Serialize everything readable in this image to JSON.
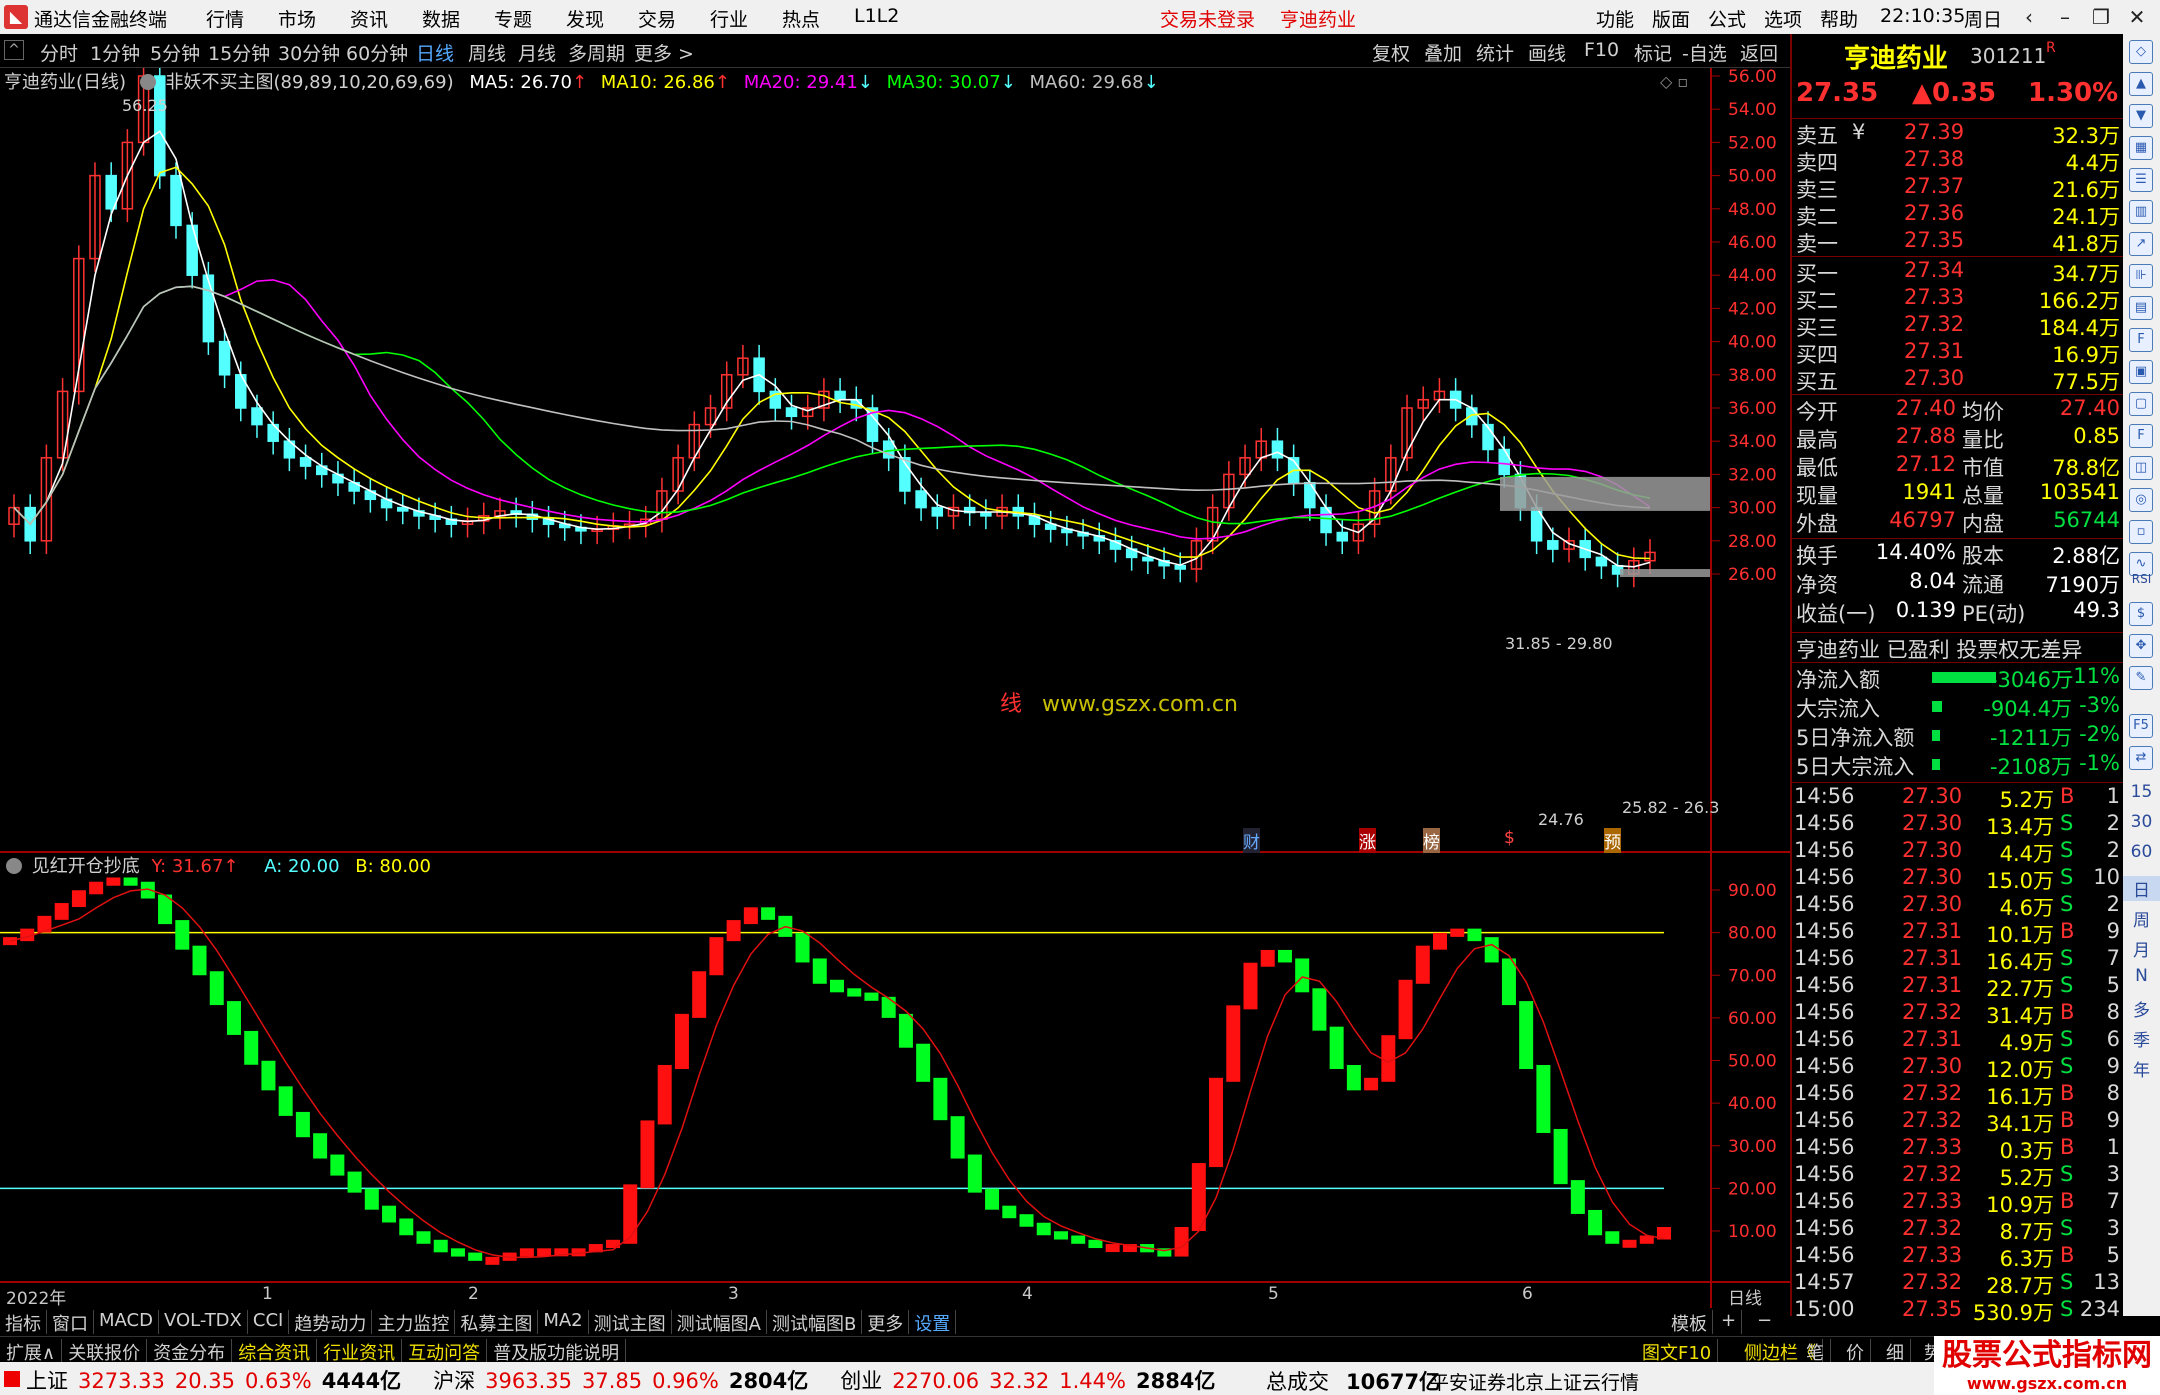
{
  "titlebar": {
    "app_name": "通达信金融终端",
    "menus": [
      "行情",
      "市场",
      "资讯",
      "数据",
      "专题",
      "发现",
      "交易",
      "行业",
      "热点",
      "L1L2"
    ],
    "trade_status": "交易未登录",
    "stock_name": "亨迪药业",
    "right_menus": [
      "功能",
      "版面",
      "公式",
      "选项",
      "帮助"
    ],
    "time": "22:10:35",
    "weekday": "周日"
  },
  "periodbar": {
    "periods": [
      "分时",
      "1分钟",
      "5分钟",
      "15分钟",
      "30分钟",
      "60分钟",
      "日线",
      "周线",
      "月线",
      "多周期",
      "更多 >"
    ],
    "active": "日线",
    "right_buttons": [
      "复权",
      "叠加",
      "统计",
      "画线",
      "F10",
      "标记",
      "-自选",
      "返回"
    ]
  },
  "main_chart": {
    "stock_label": "亨迪药业(日线)",
    "indicator": "非妖不买主图(89,89,10,20,69,69)",
    "ma5": "MA5: 26.70",
    "ma10": "MA10: 26.86",
    "ma20": "MA20: 29.41",
    "ma30": "MA30: 30.07",
    "ma60": "MA60: 29.68",
    "yaxis": [
      "56.00",
      "54.00",
      "52.00",
      "50.00",
      "48.00",
      "46.00",
      "44.00",
      "42.00",
      "40.00",
      "38.00",
      "36.00",
      "34.00",
      "32.00",
      "30.00",
      "28.00",
      "26.00"
    ],
    "high_label": "56.25",
    "zone_label": "31.85 - 29.80",
    "low_label": "24.76",
    "zone2_label": "25.82 - 26.3",
    "watermark": "www.gszx.com.cn",
    "watermark_prefix": "线",
    "event_markers": [
      "财",
      "涨",
      "榜",
      "$",
      "预"
    ],
    "colors": {
      "up": "#ff3232",
      "down": "#54ffff",
      "ma5": "#ffffff",
      "ma10": "#ffff00",
      "ma20": "#ff00ff",
      "ma30": "#00ff00",
      "ma60": "#c0c0c0"
    }
  },
  "sub_chart": {
    "name": "见红开仓抄底",
    "y_label": "Y: 31.67",
    "a_label": "A: 20.00",
    "b_label": "B: 80.00",
    "yaxis": [
      "90.00",
      "80.00",
      "70.00",
      "60.00",
      "50.00",
      "40.00",
      "30.00",
      "20.00",
      "10.00"
    ],
    "a_value": 20,
    "b_value": 80
  },
  "xaxis": {
    "labels": [
      "2022年",
      "1",
      "2",
      "3",
      "4",
      "5",
      "6"
    ],
    "right_label": "日线"
  },
  "chart_data": {
    "type": "table",
    "title": "亨迪药业(日线)",
    "subtitle": "",
    "sub_indicator_ylim": [
      0,
      100
    ],
    "sub_indicator_lines": {
      "A": 20.0,
      "B": 80.0
    },
    "last_Y": 31.67,
    "price_ylim": [
      25,
      57
    ],
    "ma_last": {
      "MA5": 26.7,
      "MA10": 26.86,
      "MA20": 29.41,
      "MA30": 30.07,
      "MA60": 29.68
    }
  },
  "quote": {
    "name": "亨迪药业",
    "code": "301211",
    "flag": "R",
    "price": "27.35",
    "change": "▲0.35",
    "pct": "1.30%",
    "asks": [
      {
        "label": "卖五",
        "mark": "¥",
        "price": "27.39",
        "vol": "32.3万"
      },
      {
        "label": "卖四",
        "mark": "",
        "price": "27.38",
        "vol": "4.4万"
      },
      {
        "label": "卖三",
        "mark": "",
        "price": "27.37",
        "vol": "21.6万"
      },
      {
        "label": "卖二",
        "mark": "",
        "price": "27.36",
        "vol": "24.1万"
      },
      {
        "label": "卖一",
        "mark": "",
        "price": "27.35",
        "vol": "41.8万"
      }
    ],
    "bids": [
      {
        "label": "买一",
        "price": "27.34",
        "vol": "34.7万"
      },
      {
        "label": "买二",
        "price": "27.33",
        "vol": "166.2万"
      },
      {
        "label": "买三",
        "price": "27.32",
        "vol": "184.4万"
      },
      {
        "label": "买四",
        "price": "27.31",
        "vol": "16.9万"
      },
      {
        "label": "买五",
        "price": "27.30",
        "vol": "77.5万"
      }
    ],
    "stats1": [
      {
        "l": "今开",
        "v": "27.40",
        "l2": "均价",
        "v2": "27.40"
      },
      {
        "l": "最高",
        "v": "27.88",
        "l2": "量比",
        "v2": "0.85"
      },
      {
        "l": "最低",
        "v": "27.12",
        "l2": "市值",
        "v2": "78.8亿"
      },
      {
        "l": "现量",
        "v": "1941",
        "l2": "总量",
        "v2": "103541"
      },
      {
        "l": "外盘",
        "v": "46797",
        "l2": "内盘",
        "v2": "56744"
      }
    ],
    "stats2": [
      {
        "l": "换手",
        "v": "14.40%",
        "l2": "股本",
        "v2": "2.88亿"
      },
      {
        "l": "净资",
        "v": "8.04",
        "l2": "流通",
        "v2": "7190万"
      },
      {
        "l": "收益(一)",
        "v": "0.139",
        "l2": "PE(动)",
        "v2": "49.3"
      }
    ],
    "banner": "亨迪药业 已盈利 投票权无差异",
    "flows": [
      {
        "l": "净流入额",
        "v": "-3046万",
        "p": "-11%",
        "bar": 0.8
      },
      {
        "l": "大宗流入",
        "v": "-904.4万",
        "p": "-3%",
        "bar": 0.12
      },
      {
        "l": "5日净流入额",
        "v": "-1211万",
        "p": "-2%",
        "bar": 0.1
      },
      {
        "l": "5日大宗流入",
        "v": "-2108万",
        "p": "-1%",
        "bar": 0.1
      }
    ],
    "ticks": [
      {
        "t": "14:56",
        "p": "27.30",
        "v": "5.2万",
        "d": "B",
        "n": "1"
      },
      {
        "t": "14:56",
        "p": "27.30",
        "v": "13.4万",
        "d": "S",
        "n": "2"
      },
      {
        "t": "14:56",
        "p": "27.30",
        "v": "4.4万",
        "d": "S",
        "n": "2"
      },
      {
        "t": "14:56",
        "p": "27.30",
        "v": "15.0万",
        "d": "S",
        "n": "10"
      },
      {
        "t": "14:56",
        "p": "27.30",
        "v": "4.6万",
        "d": "S",
        "n": "2"
      },
      {
        "t": "14:56",
        "p": "27.31",
        "v": "10.1万",
        "d": "B",
        "n": "9"
      },
      {
        "t": "14:56",
        "p": "27.31",
        "v": "16.4万",
        "d": "S",
        "n": "7"
      },
      {
        "t": "14:56",
        "p": "27.31",
        "v": "22.7万",
        "d": "S",
        "n": "5"
      },
      {
        "t": "14:56",
        "p": "27.32",
        "v": "31.4万",
        "d": "B",
        "n": "8"
      },
      {
        "t": "14:56",
        "p": "27.31",
        "v": "4.9万",
        "d": "S",
        "n": "6"
      },
      {
        "t": "14:56",
        "p": "27.30",
        "v": "12.0万",
        "d": "S",
        "n": "9"
      },
      {
        "t": "14:56",
        "p": "27.32",
        "v": "16.1万",
        "d": "B",
        "n": "8"
      },
      {
        "t": "14:56",
        "p": "27.32",
        "v": "34.1万",
        "d": "B",
        "n": "9"
      },
      {
        "t": "14:56",
        "p": "27.33",
        "v": "0.3万",
        "d": "B",
        "n": "1"
      },
      {
        "t": "14:56",
        "p": "27.32",
        "v": "5.2万",
        "d": "S",
        "n": "3"
      },
      {
        "t": "14:56",
        "p": "27.33",
        "v": "10.9万",
        "d": "B",
        "n": "7"
      },
      {
        "t": "14:56",
        "p": "27.32",
        "v": "8.7万",
        "d": "S",
        "n": "3"
      },
      {
        "t": "14:56",
        "p": "27.33",
        "v": "6.3万",
        "d": "B",
        "n": "5"
      },
      {
        "t": "14:57",
        "p": "27.32",
        "v": "28.7万",
        "d": "S",
        "n": "13"
      },
      {
        "t": "15:00",
        "p": "27.35",
        "v": "530.9万",
        "d": "S",
        "n": "234"
      }
    ]
  },
  "iconbar": {
    "texts": [
      "RSI",
      "F5",
      "15",
      "30",
      "60",
      "日",
      "周",
      "月",
      "N",
      "多",
      "季",
      "年"
    ]
  },
  "tabs1": [
    "指标",
    "窗口",
    "MACD",
    "VOL-TDX",
    "CCI",
    "趋势动力",
    "主力监控",
    "私募主图",
    "MA2",
    "测试主图",
    "测试幅图A",
    "测试幅图B",
    "更多",
    "设置"
  ],
  "tabs1_right": [
    "模板",
    "+",
    "−"
  ],
  "tabs2": [
    "扩展∧",
    "关联报价",
    "资金分布",
    "综合资讯",
    "行业资讯",
    "互动问答",
    "普及版功能说明"
  ],
  "tabs2_right": [
    "图文F10",
    "侧边栏《",
    "笔",
    "价",
    "细",
    "势"
  ],
  "statusbar": [
    {
      "name": "上证",
      "v": "3273.33",
      "c": "20.35",
      "p": "0.63%",
      "a": "4444亿"
    },
    {
      "name": "沪深",
      "v": "3963.35",
      "c": "37.85",
      "p": "0.96%",
      "a": "2804亿"
    },
    {
      "name": "创业",
      "v": "2270.06",
      "c": "32.32",
      "p": "1.44%",
      "a": "2884亿"
    }
  ],
  "status_total_label": "总成交",
  "status_total": "10677亿",
  "status_broker": "平安证券北京上证云行情",
  "site_logo": "股票公式指标网",
  "site_url": "www.gszx.com.cn"
}
